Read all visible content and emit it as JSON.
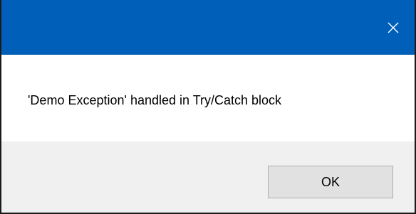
{
  "titlebar": {
    "title": "",
    "color": "#005fb8",
    "close_icon": "close-icon"
  },
  "message": {
    "text": "'Demo Exception' handled in Try/Catch block"
  },
  "buttons": {
    "ok_label": "OK"
  },
  "colors": {
    "footer": "#f0f0f0",
    "button_bg": "#e1e1e1",
    "button_border": "#adadad"
  }
}
